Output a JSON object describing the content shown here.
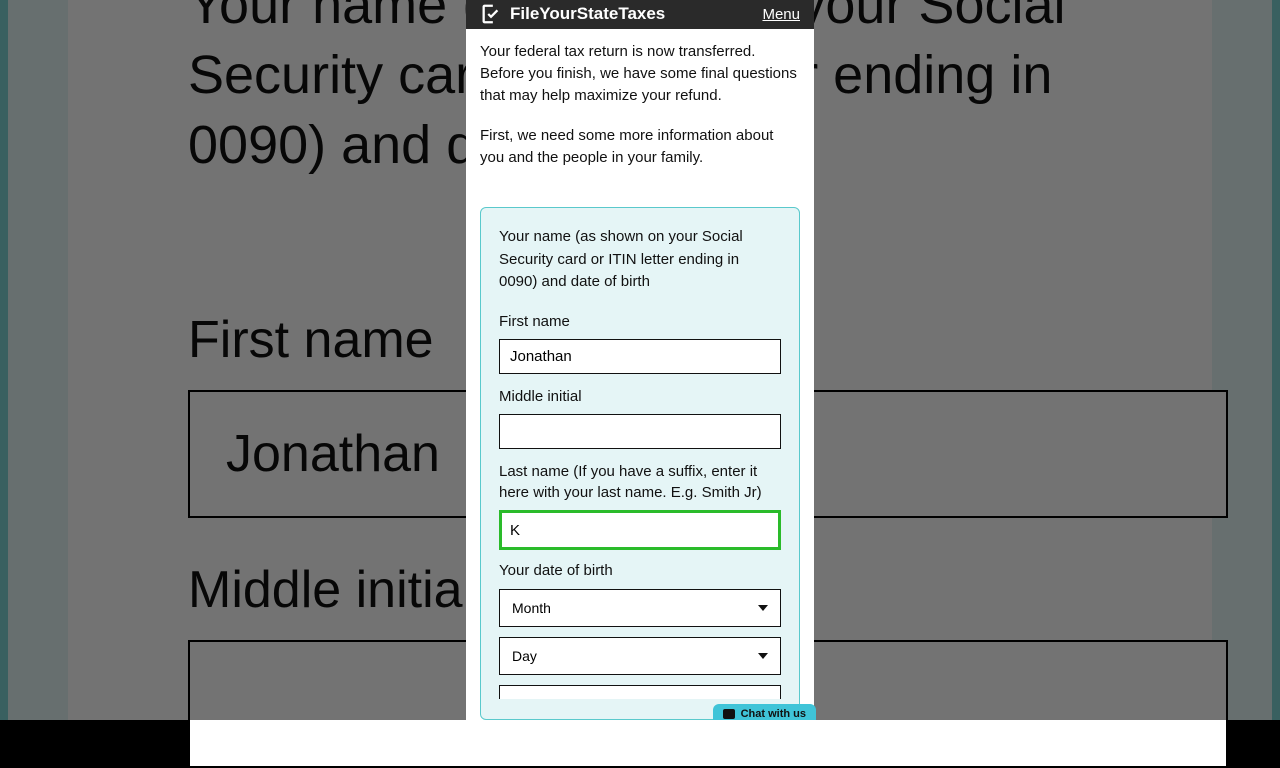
{
  "bg": {
    "heading_partial": "Your name (as shown on your Social Security card or ITIN letter ending in 0090) and date of birth",
    "first_label": "First name",
    "first_value": "Jonathan",
    "middle_label": "Middle initial"
  },
  "header": {
    "brand": "FileYourStateTaxes",
    "menu": "Menu"
  },
  "intro": {
    "p1": "Your federal tax return is now transferred. Before you finish, we have some final questions that may help maximize your refund.",
    "p2": "First, we need some more information about you and the people in your family."
  },
  "card": {
    "heading": "Your name (as shown on your Social Security card or ITIN letter ending in 0090) and date of birth",
    "first_name": {
      "label": "First name",
      "value": "Jonathan"
    },
    "middle_initial": {
      "label": "Middle initial",
      "value": ""
    },
    "last_name": {
      "label": "Last name (If you have a suffix, enter it here with your last name. E.g. Smith Jr)",
      "value": "K"
    },
    "dob": {
      "label": "Your date of birth",
      "month_placeholder": "Month",
      "day_placeholder": "Day"
    }
  },
  "chat": {
    "label": "Chat with us"
  }
}
